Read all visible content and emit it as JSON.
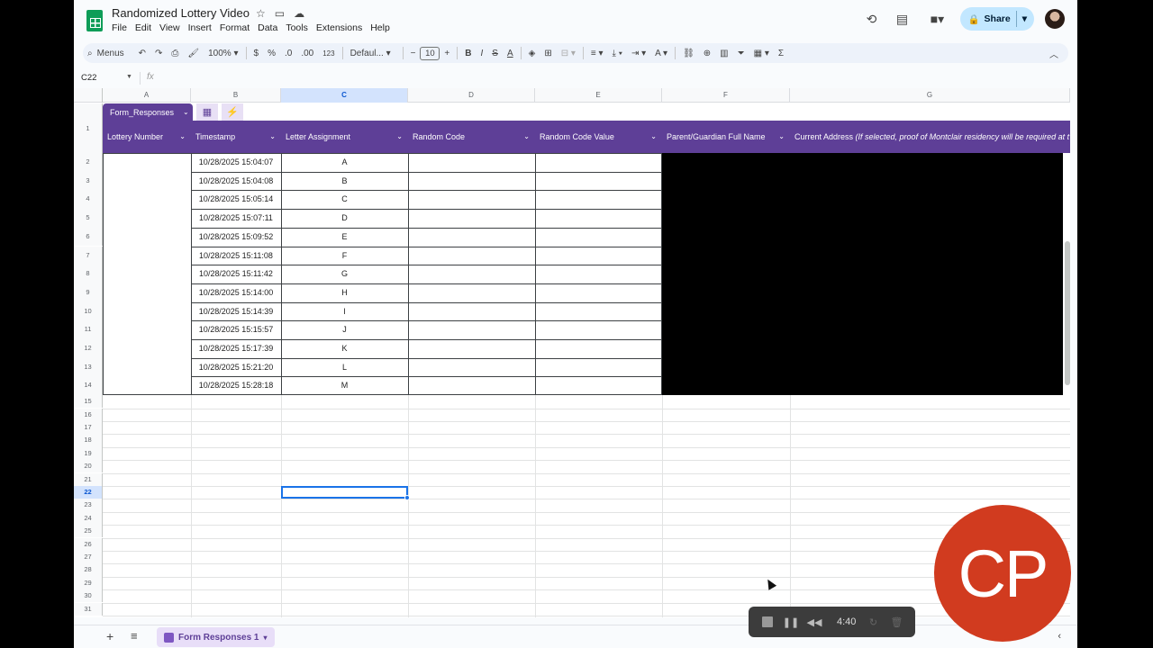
{
  "header": {
    "doc_title": "Randomized Lottery Video",
    "menus": [
      "File",
      "Edit",
      "View",
      "Insert",
      "Format",
      "Data",
      "Tools",
      "Extensions",
      "Help"
    ],
    "share_label": "Share"
  },
  "toolbar": {
    "menus_label": "Menus",
    "zoom": "100%",
    "currency": "$",
    "percent": "%",
    "dec_decrease": ".0",
    "dec_increase": ".00",
    "number_format": "123",
    "font": "Defaul...",
    "font_size": "10",
    "bold": "B",
    "italic": "I",
    "strike": "S",
    "text_color": "A",
    "sum": "Σ"
  },
  "formula_bar": {
    "name_box": "C22",
    "fx": "fx"
  },
  "columns": [
    "A",
    "B",
    "C",
    "D",
    "E",
    "F",
    "G"
  ],
  "row_numbers": [
    "1",
    "2",
    "3",
    "4",
    "5",
    "6",
    "7",
    "8",
    "9",
    "10",
    "11",
    "12",
    "13",
    "14",
    "15",
    "16",
    "17",
    "18",
    "19",
    "20",
    "21",
    "22",
    "23",
    "24",
    "25",
    "26",
    "27",
    "28",
    "29",
    "30",
    "31"
  ],
  "table": {
    "name": "Form_Responses",
    "headers": [
      "Lottery Number",
      "Timestamp",
      "Letter Assignment",
      "Random Code",
      "Random Code Value",
      "Parent/Guardian Full Name"
    ],
    "address_header_plain": "Current Address ",
    "address_header_italic": "(If selected, proof of Montclair residency will be required at t",
    "rows": [
      {
        "ts": "10/28/2025 15:04:07",
        "letter": "A"
      },
      {
        "ts": "10/28/2025 15:04:08",
        "letter": "B"
      },
      {
        "ts": "10/28/2025 15:05:14",
        "letter": "C"
      },
      {
        "ts": "10/28/2025 15:07:11",
        "letter": "D"
      },
      {
        "ts": "10/28/2025 15:09:52",
        "letter": "E"
      },
      {
        "ts": "10/28/2025 15:11:08",
        "letter": "F"
      },
      {
        "ts": "10/28/2025 15:11:42",
        "letter": "G"
      },
      {
        "ts": "10/28/2025 15:14:00",
        "letter": "H"
      },
      {
        "ts": "10/28/2025 15:14:39",
        "letter": "I"
      },
      {
        "ts": "10/28/2025 15:15:57",
        "letter": "J"
      },
      {
        "ts": "10/28/2025 15:17:39",
        "letter": "K"
      },
      {
        "ts": "10/28/2025 15:21:20",
        "letter": "L"
      },
      {
        "ts": "10/28/2025 15:28:18",
        "letter": "M"
      }
    ]
  },
  "sheet_tab": "Form Responses 1",
  "recorder": {
    "time": "4:40"
  },
  "badge": "CP",
  "colors": {
    "table_header": "#5e3f97",
    "sheets_green": "#0f9d58",
    "share_bg": "#c2e7ff",
    "badge_red": "#d13b1f",
    "selection_blue": "#1a73e8"
  }
}
